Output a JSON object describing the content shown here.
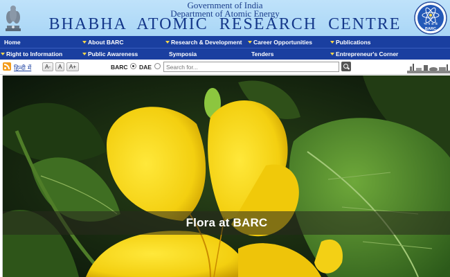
{
  "header": {
    "line1": "Government of India",
    "line2": "Department of Atomic Energy",
    "title": "BHABHA ATOMIC RESEARCH CENTRE",
    "right_logo_text": "भा प अ के",
    "right_logo_sub": "BARC",
    "emblem_icon": "state-emblem-icon"
  },
  "nav": {
    "row1": [
      "Home",
      "About BARC",
      "Research & Development",
      "Career Opportunities",
      "Publications"
    ],
    "row2": [
      "Right to Information",
      "Public Awareness",
      "Symposia",
      "Tenders",
      "Entrepreneur's Corner"
    ]
  },
  "toolbar": {
    "hindi_link": "हिन्दी में",
    "font_small": "A-",
    "font_normal": "A",
    "font_large": "A+",
    "radio_barc": "BARC",
    "radio_dae": "DAE",
    "search_placeholder": "Search for...",
    "rss_icon": "rss-icon",
    "search_icon": "search-icon"
  },
  "banner": {
    "caption": "Flora at BARC"
  },
  "colors": {
    "nav_bg": "#1a3fa0",
    "header_bg": "#a9d6f6",
    "title_color": "#14378a",
    "arrow": "#f7d64a"
  }
}
